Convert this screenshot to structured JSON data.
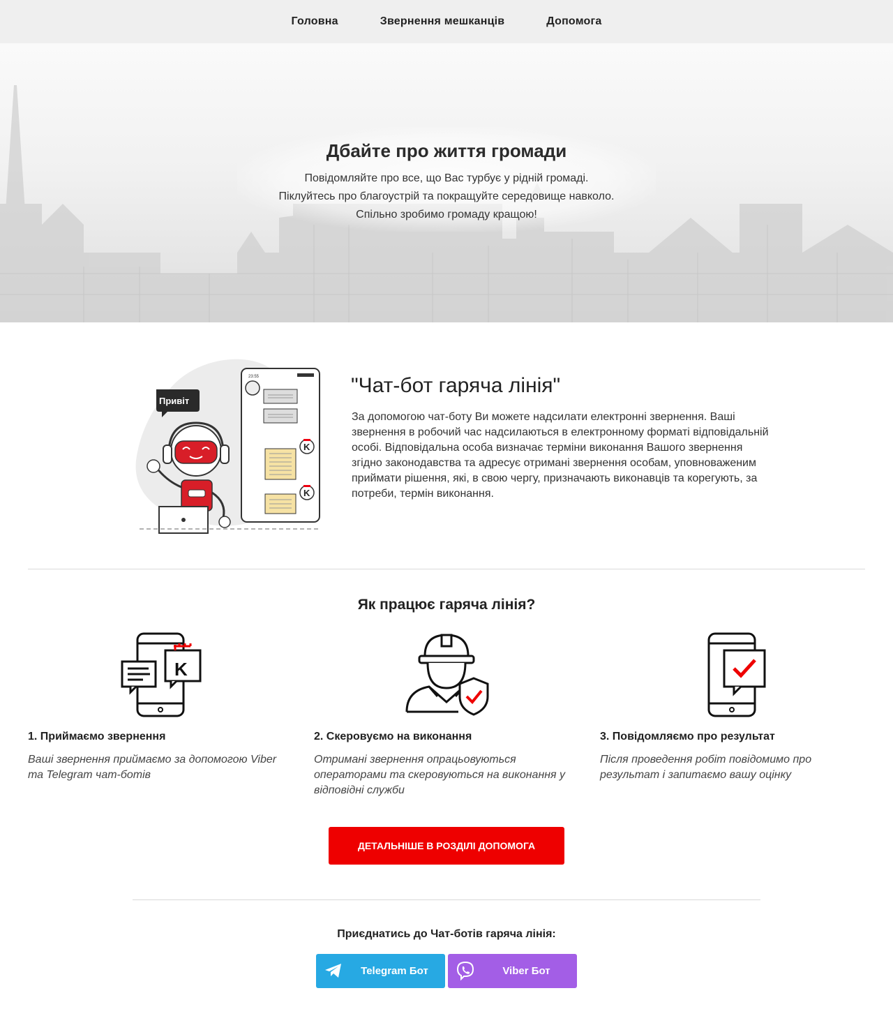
{
  "nav": {
    "items": [
      "Головна",
      "Звернення мешканців",
      "Допомога"
    ]
  },
  "hero": {
    "title": "Дбайте про життя громади",
    "lines": [
      "Повідомляйте про все, що Вас турбує у рідній громаді.",
      "Піклуйтесь про благоустрій та покращуйте середовище навколо.",
      "Спільно зробимо громаду кращою!"
    ]
  },
  "chatbot": {
    "title": "\"Чат-бот гаряча лінія\"",
    "text": "За допомогою чат-боту Ви можете надсилати електронні звернення. Ваші звернення в робочий час надсилаються в електронному форматі відповідальній особі. Відповідальна особа визначає терміни виконання Вашого звернення згідно законодавства та адресує отримані звернення особам, уповноваженим приймати рішення, які, в свою чергу, призначають виконавців та корегують, за потреби, термін виконання.",
    "illustration": {
      "bubble": "Привіт",
      "phone_time": "23:55",
      "badge_letter": "K"
    }
  },
  "how": {
    "title": "Як працює гаряча лінія?",
    "steps": [
      {
        "title": "1. Приймаємо звернення",
        "text": "Ваші звернення приймаємо за допомогою Viber та Telegram чат-ботів",
        "icon": "phone-chat-icon"
      },
      {
        "title": "2. Скеровуємо на виконання",
        "text": "Отримані звернення опрацьовуються операторами та скеровуються на виконання у відповідні служби",
        "icon": "worker-shield-icon"
      },
      {
        "title": "3. Повідомляємо про результат",
        "text": "Після проведення робіт повідомимо про результат і запитаємо вашу оцінку",
        "icon": "phone-check-icon"
      }
    ]
  },
  "cta": {
    "label": "Детальніше в розділі Допомога"
  },
  "join": {
    "title": "Приєднатись до Чат-ботів гаряча лінія:",
    "telegram": "Telegram Бот",
    "viber": "Viber Бот"
  },
  "colors": {
    "accent_red": "#ee0000",
    "telegram": "#27a9e3",
    "viber": "#a35ee6",
    "nav_bg": "#efefef"
  }
}
